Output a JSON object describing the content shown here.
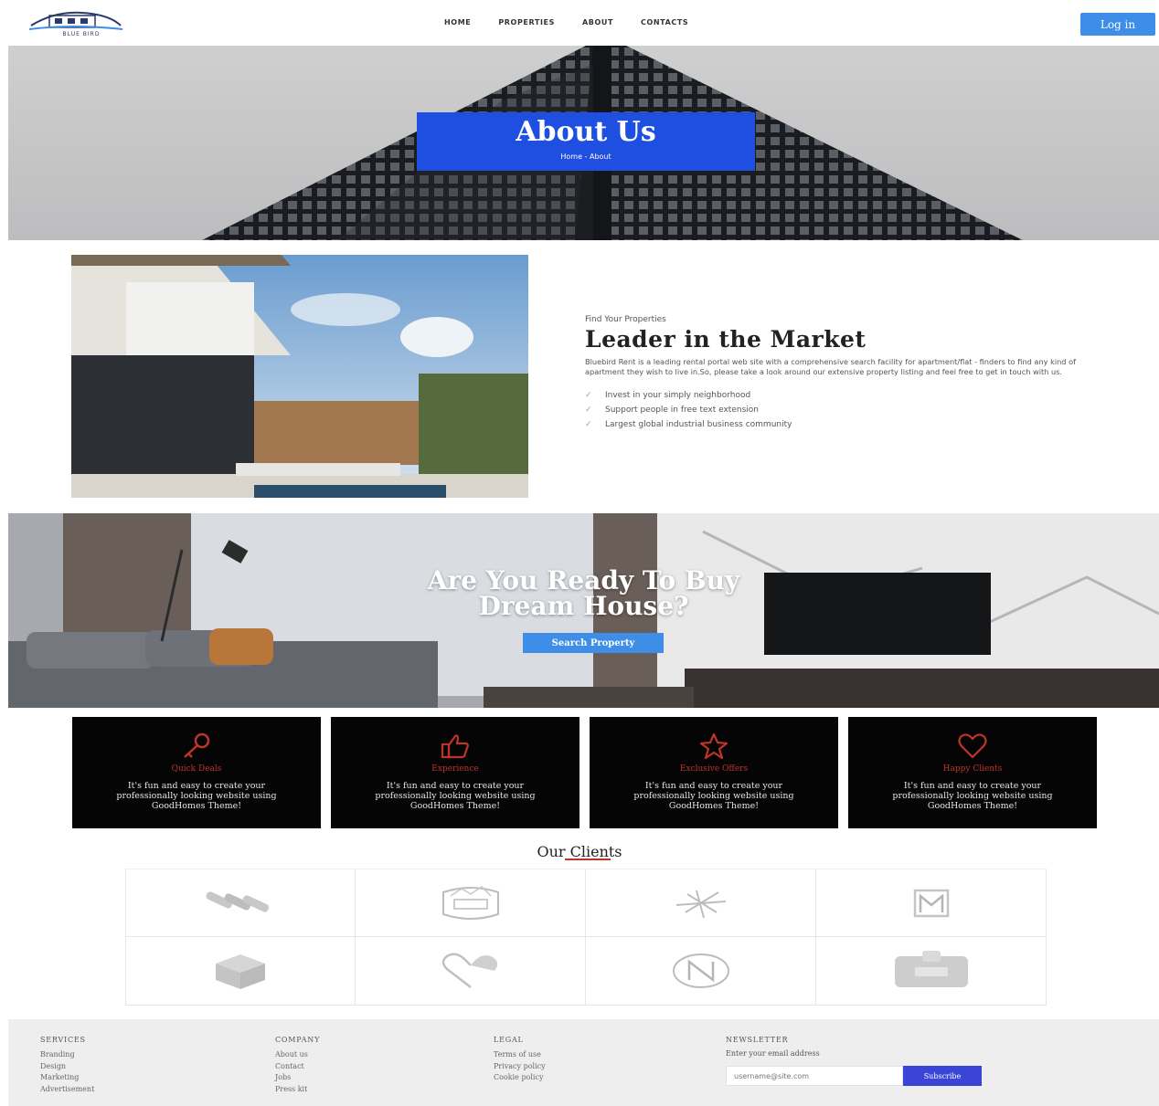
{
  "header": {
    "logo_text": "BLUE BIRD",
    "nav": [
      "HOME",
      "PROPERTIES",
      "ABOUT",
      "CONTACTS"
    ],
    "login_label": "Log in"
  },
  "hero": {
    "title": "About Us",
    "breadcrumb": "Home - About"
  },
  "about": {
    "eyebrow": "Find Your Properties",
    "title": "Leader in the Market",
    "description": "Bluebird Rent is a leading rental portal web site with a comprehensive search facility for apartment/flat - finders to find any kind of apartment they wish to live in.So, please take a look around our extensive property listing and feel free to get in touch with us.",
    "features": [
      "Invest in your simply neighborhood",
      "Support people in free text extension",
      "Largest global industrial business community"
    ]
  },
  "cta": {
    "title_line1": "Are You Ready To Buy",
    "title_line2": "Dream House?",
    "button_label": "Search Property"
  },
  "features": [
    {
      "icon": "key-icon",
      "name": "Quick Deals",
      "desc": "It's fun and easy to create your professionally looking website using GoodHomes Theme!"
    },
    {
      "icon": "thumbs-up-icon",
      "name": "Experience",
      "desc": "It's fun and easy to create your professionally looking website using GoodHomes Theme!"
    },
    {
      "icon": "star-icon",
      "name": "Exclusive Offers",
      "desc": "It's fun and easy to create your professionally looking website using GoodHomes Theme!"
    },
    {
      "icon": "heart-icon",
      "name": "Happy Clients",
      "desc": "It's fun and easy to create your professionally looking website using GoodHomes Theme!"
    }
  ],
  "clients": {
    "title": "Our Clients",
    "logos": [
      "stripes-logo",
      "badge-logo",
      "palm-logo",
      "m-monogram-logo",
      "cube-logo",
      "heart-shape-logo",
      "n-circle-logo",
      "box-logo"
    ]
  },
  "footer": {
    "services": {
      "heading": "SERVICES",
      "links": [
        "Branding",
        "Design",
        "Marketing",
        "Advertisement"
      ]
    },
    "company": {
      "heading": "COMPANY",
      "links": [
        "About us",
        "Contact",
        "Jobs",
        "Press kit"
      ]
    },
    "legal": {
      "heading": "LEGAL",
      "links": [
        "Terms of use",
        "Privacy policy",
        "Cookie policy"
      ]
    },
    "newsletter": {
      "heading": "NEWSLETTER",
      "label": "Enter your email address",
      "placeholder": "username@site.com",
      "button_label": "Subscribe"
    }
  },
  "colors": {
    "accent_blue": "#1e4fe0",
    "button_blue": "#3e8ee8",
    "feature_red": "#c0332a",
    "card_black": "#050505"
  }
}
